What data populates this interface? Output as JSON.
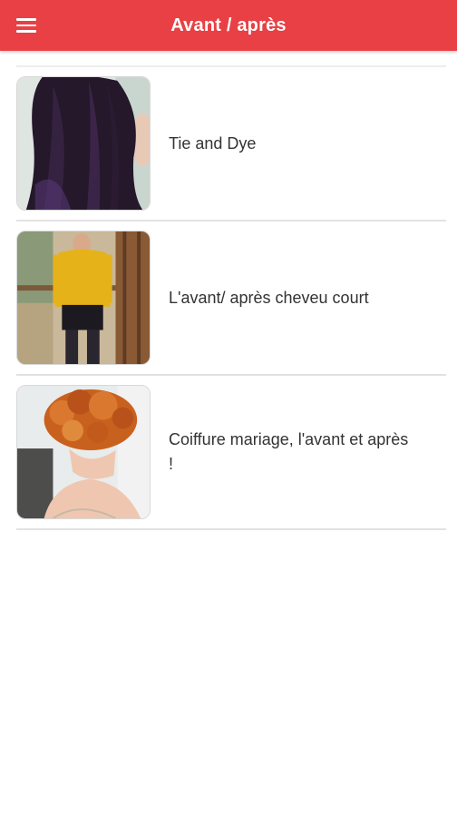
{
  "appbar": {
    "title": "Avant / après",
    "menu_icon": "hamburger-menu-icon",
    "color": "#e84044"
  },
  "items": [
    {
      "label": "Tie and Dye",
      "image": "dark-purple-straight-hair-photo"
    },
    {
      "label": "L'avant/ après cheveu court",
      "image": "woman-yellow-sweater-photo"
    },
    {
      "label": "Coiffure mariage, l'avant et après !",
      "image": "red-curly-updo-photo"
    }
  ]
}
